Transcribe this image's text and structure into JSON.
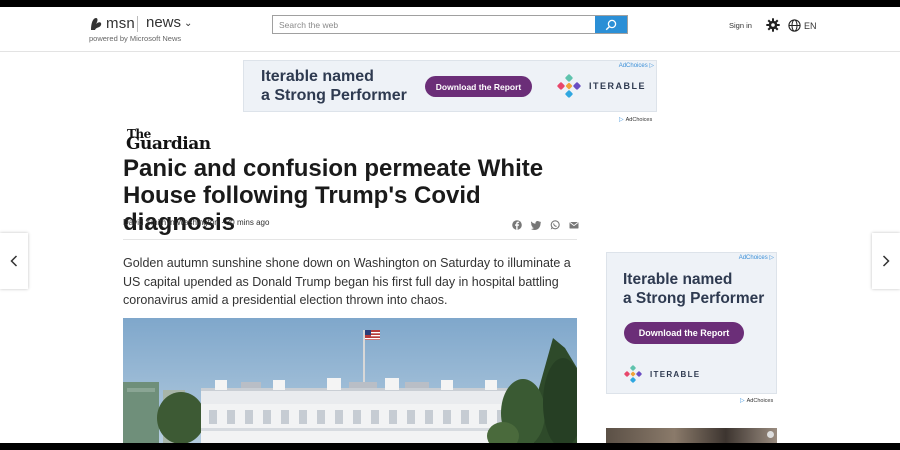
{
  "header": {
    "brand": "msn",
    "section": "news",
    "powered_by": "powered by Microsoft News",
    "search_placeholder": "Search the web",
    "sign_in": "Sign in",
    "language": "EN"
  },
  "top_ad": {
    "line1": "Iterable named",
    "line2": "a Strong Performer",
    "cta": "Download the Report",
    "brand": "ITERABLE",
    "adchoices_corner": "AdChoices",
    "adchoices_below": "AdChoices"
  },
  "article": {
    "publisher_the": "The",
    "publisher_name": "Guardian",
    "headline": "Panic and confusion permeate White House following Trump's Covid diagnosis",
    "byline": "David Smith in Washington · 30 mins ago",
    "lede": "Golden autumn sunshine shone down on Washington on Saturday to illuminate a US capital upended as Donald Trump began his first full day in hospital battling coronavirus amid a presidential election thrown into chaos.",
    "share_icons": [
      "facebook-icon",
      "twitter-icon",
      "whatsapp-icon",
      "email-icon"
    ]
  },
  "right_ad": {
    "line1": "Iterable named",
    "line2": "a Strong Performer",
    "cta": "Download the Report",
    "brand": "ITERABLE",
    "adchoices_corner": "AdChoices",
    "adchoices_below": "AdChoices"
  },
  "colors": {
    "search_button": "#2b8fd6",
    "ad_button": "#6b2e78",
    "ad_background": "#eef2f7"
  }
}
